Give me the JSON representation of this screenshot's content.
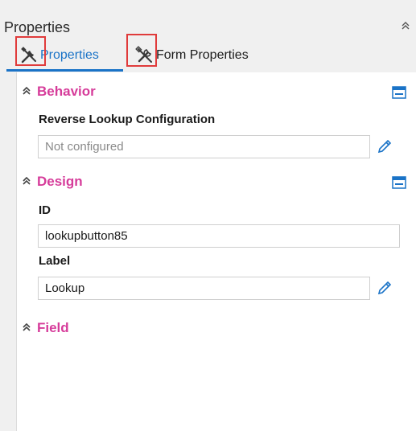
{
  "panel": {
    "title": "Properties"
  },
  "tabs": [
    {
      "label": "Properties",
      "active": true
    },
    {
      "label": "Form Properties",
      "active": false
    }
  ],
  "sections": {
    "behavior": {
      "title": "Behavior",
      "fields": {
        "reverse_lookup": {
          "label": "Reverse Lookup Configuration",
          "value": "Not configured"
        }
      }
    },
    "design": {
      "title": "Design",
      "fields": {
        "id": {
          "label": "ID",
          "value": "lookupbutton85"
        },
        "label": {
          "label": "Label",
          "value": "Lookup"
        }
      }
    },
    "field": {
      "title": "Field"
    }
  },
  "colors": {
    "accent_tab": "#1a73c7",
    "section_title": "#d63c9a",
    "highlight_box": "#e03b3b"
  }
}
